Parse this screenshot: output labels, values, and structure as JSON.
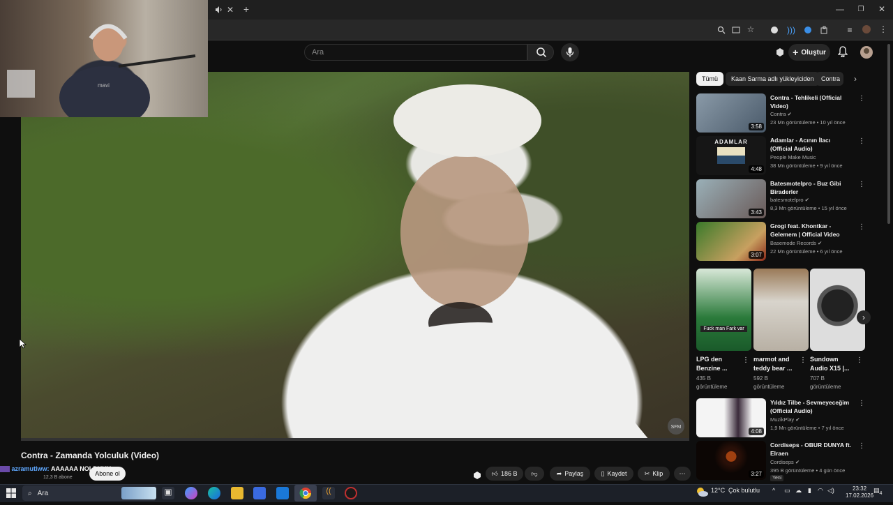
{
  "browser": {
    "tab_icons": [
      "mute-icon",
      "close-icon",
      "new-tab-icon"
    ],
    "window_controls": [
      "minimize",
      "restore",
      "close"
    ]
  },
  "header": {
    "search_placeholder": "Ara",
    "create_label": "Oluştur"
  },
  "video": {
    "title": "Contra - Zamanda Yolculuk (Video)",
    "subscribers": "12,3 B abone",
    "subscribe_label": "Abone ol",
    "like_count": "186 B",
    "share_label": "Paylaş",
    "save_label": "Kaydet",
    "clip_label": "Klip",
    "watermark": "SFM",
    "progress": 0.0
  },
  "chat": {
    "user": "azramutlww:",
    "message": "AAAAAA NOLDUUU"
  },
  "chips": [
    "Tümü",
    "Kaan Sarma adlı yükleyiciden",
    "Contra"
  ],
  "recommendations": [
    {
      "title": "Contra - Tehlikeli (Official Video)",
      "channel": "Contra",
      "verified": true,
      "views": "23 Mn görüntüleme",
      "age": "10 yıl önce",
      "duration": "3:58",
      "thumb_color": "#5a6a7a"
    },
    {
      "title": "Adamlar - Acının İlacı (Official Audio)",
      "channel": "People Make Music",
      "verified": false,
      "views": "38 Mn görüntüleme",
      "age": "9 yıl önce",
      "duration": "4:48",
      "thumb_color": "#1a1a1a",
      "thumb_text": "ADAMLAR"
    },
    {
      "title": "Batesmotelpro - Buz Gibi Biraderler",
      "channel": "batesmotelpro",
      "verified": true,
      "views": "8,3 Mn görüntüleme",
      "age": "15 yıl önce",
      "duration": "3:43",
      "thumb_color": "#7a8a9a"
    },
    {
      "title": "Grogi feat. Khontkar - Gelemem | Official Video",
      "channel": "Basemode Records",
      "verified": true,
      "views": "22 Mn görüntüleme",
      "age": "6 yıl önce",
      "duration": "3:07",
      "thumb_color": "#3a6a2a"
    },
    {
      "title": "Yıldız Tilbe - Sevmeyeceğim (Official Audio)",
      "channel": "MuzikPlay",
      "verified": true,
      "views": "1,9 Mn görüntüleme",
      "age": "7 yıl önce",
      "duration": "4:08",
      "thumb_color": "#f0f0f0"
    },
    {
      "title": "Cordiseps - OBUR DUNYA ft. Elraen",
      "channel": "Cordiseps",
      "verified": true,
      "views": "395 B görüntüleme",
      "age": "4 gün önce",
      "duration": "3:27",
      "badge": "Yeni",
      "thumb_color": "#1a0e08"
    }
  ],
  "shorts": [
    {
      "title": "LPG den Benzine ...",
      "views": "435 B görüntüleme",
      "overlay": "Fuck man Fark var",
      "thumb_color": "#2a6a3a"
    },
    {
      "title": "marmot and teddy bear ...",
      "views": "592 B görüntüleme",
      "thumb_color": "#b8b0a4"
    },
    {
      "title": "Sundown Audio X15 |...",
      "views": "707 B görüntüleme",
      "thumb_color": "#d0d0d0"
    }
  ],
  "taskbar": {
    "search_label": "Ara",
    "weather_temp": "12°C",
    "weather_desc": "Çok bulutlu",
    "time": "23:32",
    "date": "17.02.2026",
    "notifications": "4"
  }
}
